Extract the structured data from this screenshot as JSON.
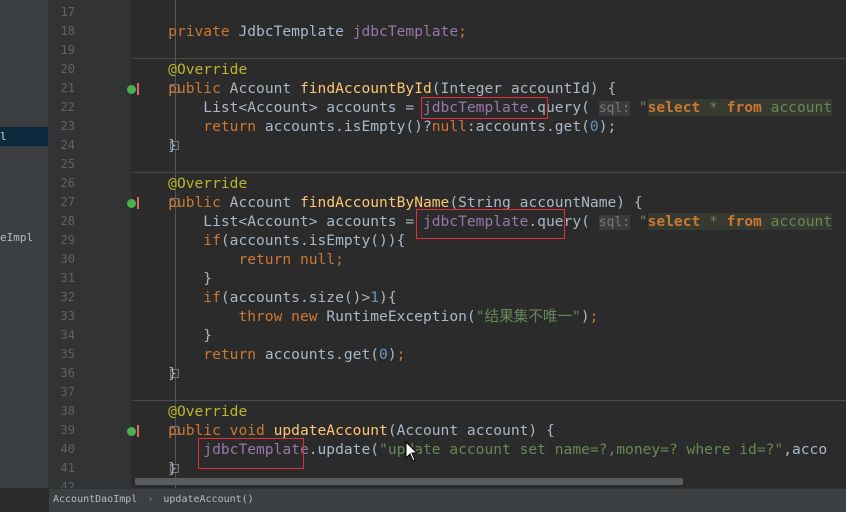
{
  "left_panel": {
    "items": [
      {
        "label": "l",
        "selected": true
      },
      {
        "label": "eImpl",
        "selected": false
      }
    ]
  },
  "gutter": {
    "line_numbers": [
      "17",
      "18",
      "19",
      "20",
      "21",
      "22",
      "23",
      "24",
      "25",
      "26",
      "27",
      "28",
      "29",
      "30",
      "31",
      "32",
      "33",
      "34",
      "35",
      "36",
      "37",
      "38",
      "39",
      "40",
      "41",
      "42"
    ],
    "override_marks": [
      "21",
      "27",
      "39"
    ]
  },
  "editor": {
    "lines": [
      [],
      [
        [
          "",
          "    "
        ],
        [
          "kw",
          "private "
        ],
        [
          "",
          "JdbcTemplate "
        ],
        [
          "fd",
          "jdbcTemplate"
        ],
        [
          "kw",
          ";"
        ]
      ],
      [],
      [
        [
          "",
          "    "
        ],
        [
          "an",
          "@Override"
        ]
      ],
      [
        [
          "",
          "    "
        ],
        [
          "kw",
          "public "
        ],
        [
          "",
          "Account "
        ],
        [
          "fn",
          "findAccountById"
        ],
        [
          "",
          "(Integer accountId) {"
        ]
      ],
      [
        [
          "",
          "        List<Account> accounts = "
        ],
        [
          "fd",
          "jdbcTemplate"
        ],
        [
          "",
          ".query( "
        ],
        [
          "hint",
          "sql:"
        ],
        [
          "st",
          " \""
        ],
        [
          "sqk",
          "select"
        ],
        [
          "sq",
          " * "
        ],
        [
          "sqk",
          "from"
        ],
        [
          "sq",
          " account"
        ]
      ],
      [
        [
          "",
          "        "
        ],
        [
          "kw",
          "return "
        ],
        [
          "",
          "accounts.isEmpty()?"
        ],
        [
          "kw",
          "null"
        ],
        [
          "",
          ":accounts.get("
        ],
        [
          "nm",
          "0"
        ],
        [
          "",
          "); "
        ]
      ],
      [
        [
          "",
          "    }"
        ]
      ],
      [],
      [
        [
          "",
          "    "
        ],
        [
          "an",
          "@Override"
        ]
      ],
      [
        [
          "",
          "    "
        ],
        [
          "kw",
          "public "
        ],
        [
          "",
          "Account "
        ],
        [
          "fn",
          "findAccountByName"
        ],
        [
          "",
          "(String accountName) {"
        ]
      ],
      [
        [
          "",
          "        List<Account> accounts = "
        ],
        [
          "fd",
          "jdbcTemplate"
        ],
        [
          "",
          ".query( "
        ],
        [
          "hint",
          "sql:"
        ],
        [
          "st",
          " \""
        ],
        [
          "sqk",
          "select"
        ],
        [
          "sq",
          " * "
        ],
        [
          "sqk",
          "from"
        ],
        [
          "sq",
          " account"
        ]
      ],
      [
        [
          "",
          "        "
        ],
        [
          "kw",
          "if"
        ],
        [
          "",
          "(accounts.isEmpty()){"
        ]
      ],
      [
        [
          "",
          "            "
        ],
        [
          "kw",
          "return null;"
        ]
      ],
      [
        [
          "",
          "        }"
        ]
      ],
      [
        [
          "",
          "        "
        ],
        [
          "kw",
          "if"
        ],
        [
          "",
          "(accounts.size()>"
        ],
        [
          "nm",
          "1"
        ],
        [
          "",
          "){"
        ]
      ],
      [
        [
          "",
          "            "
        ],
        [
          "kw",
          "throw new "
        ],
        [
          "",
          "RuntimeException("
        ],
        [
          "st",
          "\"结果集不唯一\""
        ],
        [
          "",
          ")"
        ],
        [
          "kw",
          ";"
        ]
      ],
      [
        [
          "",
          "        }"
        ]
      ],
      [
        [
          "",
          "        "
        ],
        [
          "kw",
          "return "
        ],
        [
          "",
          "accounts.get("
        ],
        [
          "nm",
          "0"
        ],
        [
          "",
          ")"
        ],
        [
          "kw",
          ";"
        ]
      ],
      [
        [
          "",
          "    }"
        ]
      ],
      [],
      [
        [
          "",
          "    "
        ],
        [
          "an",
          "@Override"
        ]
      ],
      [
        [
          "",
          "    "
        ],
        [
          "kw",
          "public void "
        ],
        [
          "fn",
          "updateAccount"
        ],
        [
          "",
          "(Account account) {"
        ]
      ],
      [
        [
          "",
          "        "
        ],
        [
          "fd",
          "jdbcTemplate"
        ],
        [
          "",
          ".update("
        ],
        [
          "st",
          "\"update account set name=?,money=? where id=?\""
        ],
        [
          "",
          ",acco"
        ]
      ],
      [
        [
          "",
          "    }"
        ]
      ],
      []
    ]
  },
  "breadcrumb": {
    "class": "AccountDaoImpl",
    "separator": "›",
    "method": "updateAccount()"
  },
  "colors": {
    "keyword": "#cc7832",
    "method": "#ffc66d",
    "field": "#9876aa",
    "annotation": "#bbb529",
    "string": "#6a8759",
    "number": "#6897bb",
    "highlight_box": "#e0303a"
  }
}
